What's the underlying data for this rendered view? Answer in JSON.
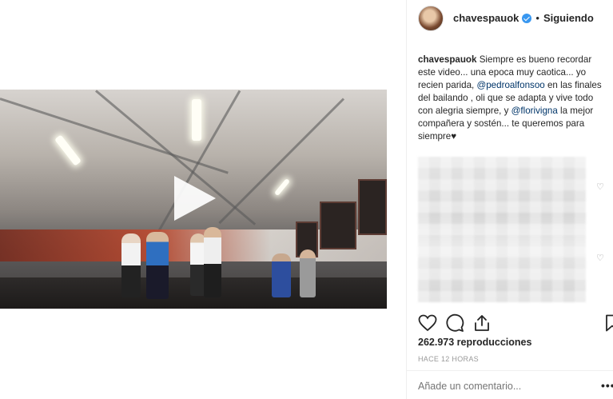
{
  "post": {
    "username": "chavespauok",
    "separator": "•",
    "follow_label": "Siguiendo"
  },
  "caption": {
    "username": "chavespauok",
    "part1": " Siempre es bueno recordar este video... una epoca muy caotica... yo recien parida, ",
    "mention1": "@pedroalfonsoo",
    "part2": " en las finales del bailando , oli que se adapta y vive todo con alegria siempre, y ",
    "mention2": "@florivigna",
    "part3": " la mejor compañera y sostén... te queremos para siempre♥"
  },
  "stats": {
    "views": "262.973 reproducciones",
    "time": "HACE 12 HORAS"
  },
  "comment": {
    "placeholder": "Añade un comentario..."
  },
  "icons": {
    "like": "heart-icon",
    "comment": "comment-icon",
    "share": "share-icon",
    "save": "bookmark-icon",
    "play": "play-icon",
    "more": "more-options-icon"
  },
  "colors": {
    "verified": "#3897f0",
    "mention": "#003569",
    "muted": "#999999"
  }
}
